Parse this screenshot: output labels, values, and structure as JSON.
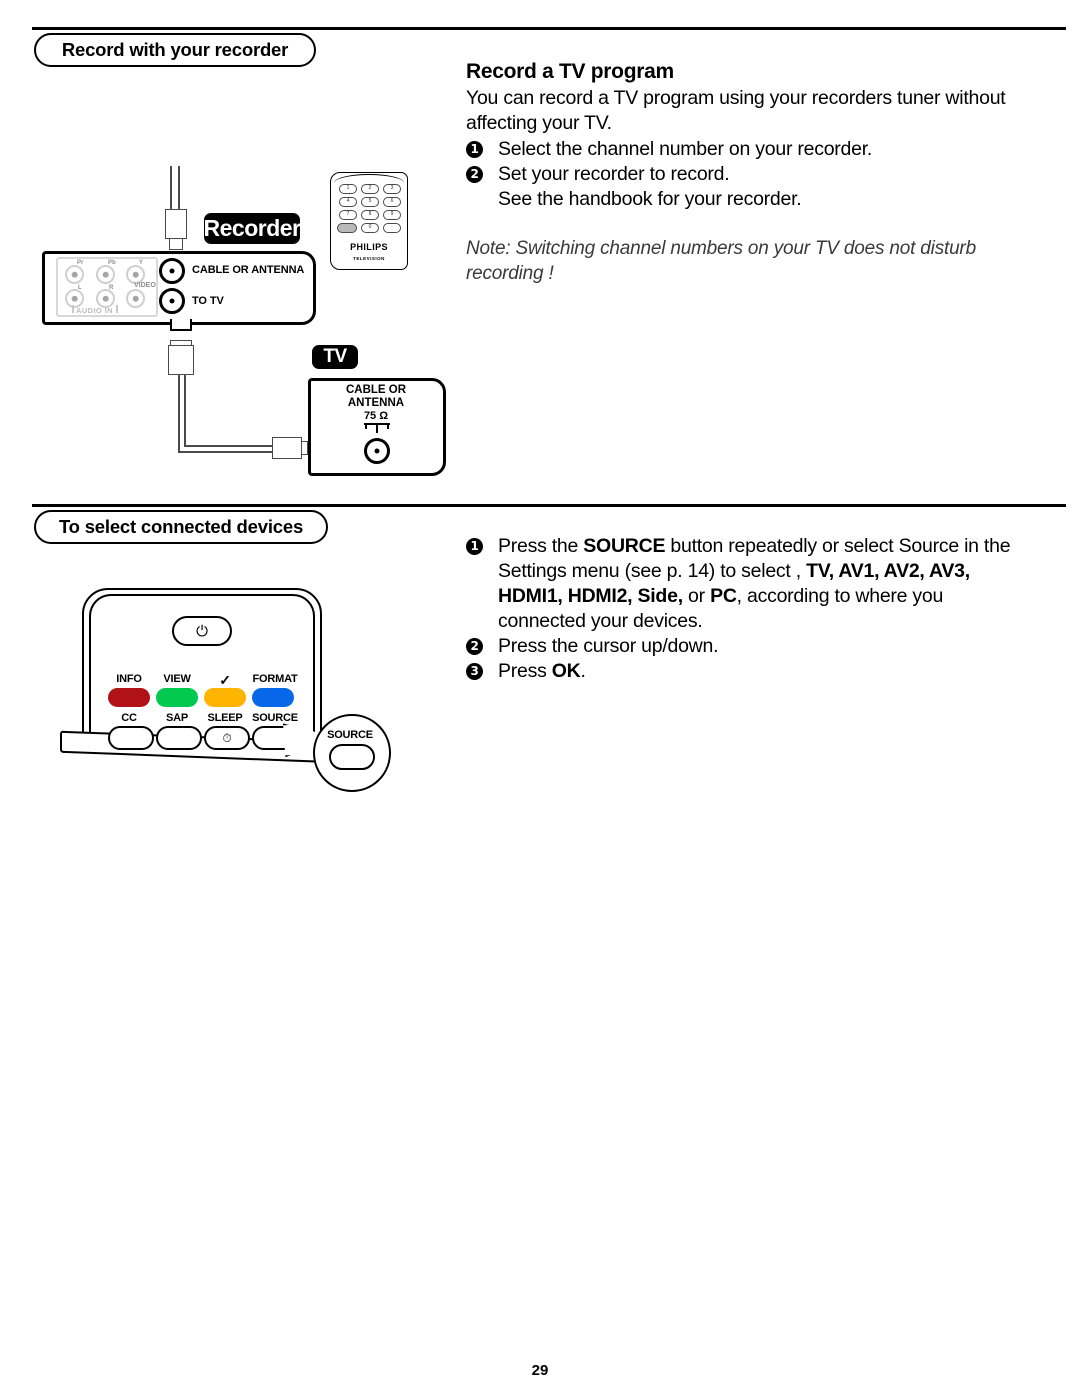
{
  "page": {
    "number": "29"
  },
  "sections": [
    {
      "id": "record",
      "title": "Record with your recorder"
    },
    {
      "id": "select",
      "title": "To select connected devices"
    }
  ],
  "record_section": {
    "heading": "Record a TV program",
    "intro": "You can record a TV program using your recorders tuner without affecting your TV.",
    "steps": [
      {
        "num": "1",
        "text": "Select the channel number on your recorder."
      },
      {
        "num": "2",
        "text": "Set your recorder to record.",
        "sub": "See the handbook for your recorder."
      }
    ],
    "note": "Note: Switching channel numbers on your TV does not disturb recording !"
  },
  "select_section": {
    "steps": [
      {
        "num": "1",
        "prefix": "Press the ",
        "b1": "SOURCE",
        "mid1": " button repeatedly or select Source in the Settings menu (see p. 14) to select , ",
        "b2": "TV, AV1, AV2, AV3, HDMI1, HDMI2, Side,",
        "mid2": " or ",
        "b3": "PC",
        "suffix": ", according to where you connected your devices."
      },
      {
        "num": "2",
        "text": "Press the cursor up/down."
      },
      {
        "num": "3",
        "prefix": "Press ",
        "b1": "OK",
        "suffix": "."
      }
    ]
  },
  "recorder_diagram": {
    "badge": "Recorder",
    "jacks_top": [
      "Pr",
      "Pb",
      "Y"
    ],
    "jacks_bottom": [
      "L",
      "R",
      "VIDEO"
    ],
    "audio_in_label": "AUDIO IN",
    "coax_ports": [
      "CABLE OR ANTENNA",
      "TO TV"
    ],
    "philips_remote": {
      "brand": "PHILIPS",
      "subtitle": "TELEVISION",
      "keys": [
        "1",
        "2",
        "3",
        "4",
        "5",
        "6",
        "7",
        "8",
        "9",
        "",
        "0",
        "·"
      ]
    }
  },
  "tv_diagram": {
    "badge": "TV",
    "port_label_line1": "CABLE OR",
    "port_label_line2": "ANTENNA",
    "impedance": "75 Ω"
  },
  "tv_remote": {
    "power_icon": "⏻",
    "color_row": [
      {
        "label": "INFO",
        "color": "#b01217"
      },
      {
        "label": "VIEW",
        "color": "#02c94f"
      },
      {
        "label": "✓",
        "color": "#ffb400"
      },
      {
        "label": "FORMAT",
        "color": "#0668e8"
      }
    ],
    "bottom_row": [
      "CC",
      "SAP",
      "SLEEP",
      "SOURCE"
    ],
    "callout_label": "SOURCE"
  }
}
